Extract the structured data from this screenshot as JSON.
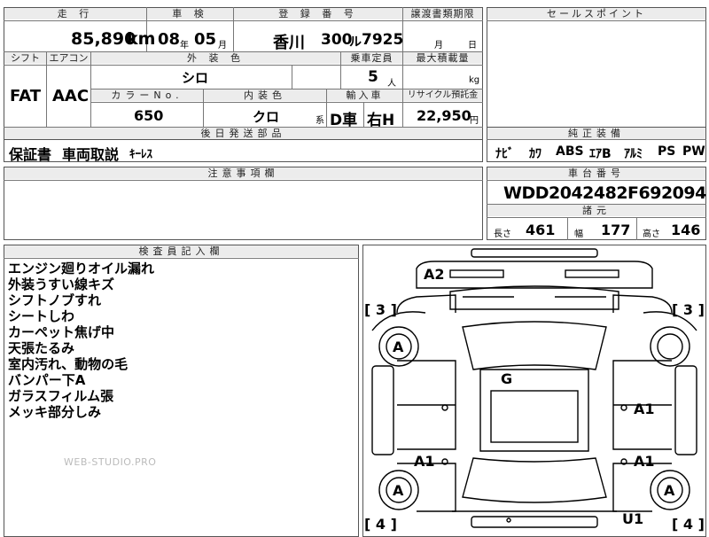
{
  "headers": {
    "mileage": "走 行",
    "inspection": "車 検",
    "registration": "登 録 番 号",
    "transfer_deadline": "譲渡書類期限",
    "sales_point": "セールスポイント",
    "shift": "シフト",
    "aircon": "エアコン",
    "exterior_color": "外 装 色",
    "capacity": "乗車定員",
    "max_load": "最大積載量",
    "color_no": "カラーNo.",
    "interior_color": "内装色",
    "import": "輸入車",
    "recycle": "リサイクル預託金",
    "later_parts": "後日発送部品",
    "genuine_equipment": "純正装備",
    "caution": "注意事項欄",
    "chassis": "車台番号",
    "dimensions": "諸元",
    "inspector_notes": "検査員記入欄"
  },
  "vehicle": {
    "mileage": "85,890",
    "mileage_unit": "km",
    "inspection_year": "08",
    "year_unit": "年",
    "inspection_month": "05",
    "month_unit": "月",
    "plate_region": "香川",
    "plate_class": "300",
    "plate_kana": "ル",
    "plate_number": "7925",
    "deadline_month_unit": "月",
    "deadline_day_unit": "日",
    "shift": "FAT",
    "aircon": "AAC",
    "exterior_color": "シロ",
    "capacity": "5",
    "capacity_unit": "人",
    "max_load_unit": "kg",
    "color_no": "650",
    "interior_color": "クロ",
    "interior_suffix": "系",
    "drive_side": "D車",
    "steering": "右H",
    "recycle_fee": "22,950",
    "recycle_unit": "円",
    "chassis_no": "WDD2042482F692094"
  },
  "later_parts": [
    "保証書",
    "車両取説",
    "ｷｰﾚｽ"
  ],
  "equipment": [
    "ﾅﾋﾞ",
    "ｶﾜ",
    "ABS",
    "ｴｱB",
    "ｱﾙﾐ",
    "PS",
    "PW"
  ],
  "dimensions": {
    "length_label": "長さ",
    "length": "461",
    "width_label": "幅",
    "width": "177",
    "height_label": "高さ",
    "height": "146"
  },
  "inspector_notes": [
    "エンジン廻りオイル漏れ",
    "外装うすい線キズ",
    "シフトノブすれ",
    "シートしわ",
    "カーペット焦げ中",
    "天張たるみ",
    "室内汚れ、動物の毛",
    "バンパー下A",
    "ガラスフィルム張",
    "メッキ部分しみ"
  ],
  "diagram": {
    "marks": {
      "front_bumper": "A2",
      "tire_left_front": "[ 3 ]",
      "tire_right_front": "[ 3 ]",
      "fender_left": "A",
      "windshield": "G",
      "door_right_front": "A1",
      "door_left_rear": "A1",
      "door_right_rear": "A1",
      "fender_left_rear": "A",
      "fender_right_rear": "A",
      "rear": "U1",
      "tire_left_rear": "[ 4 ]",
      "tire_right_rear": "[ 4 ]"
    }
  },
  "watermark": "WEB-STUDIO.PRO"
}
